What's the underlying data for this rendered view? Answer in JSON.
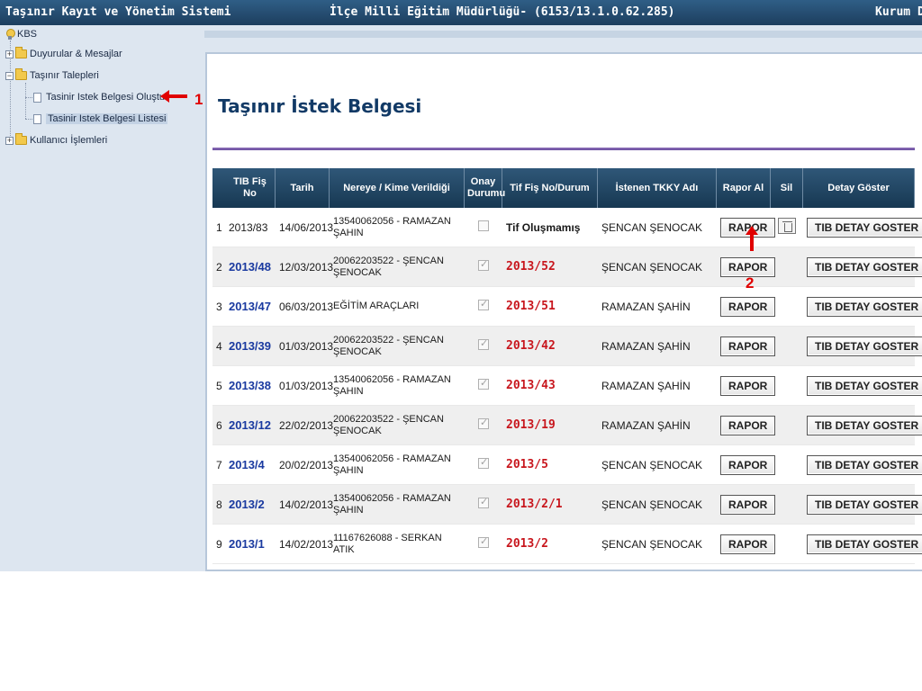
{
  "header": {
    "left_title": "Taşınır Kayıt ve Yönetim Sistemi",
    "center_title": "İlçe Milli Eğitim Müdürlüğü- (6153/13.1.0.62.285)",
    "right_title": "Kurum De"
  },
  "sidebar": {
    "root_label": "KBS",
    "items": [
      {
        "label": "Duyurular & Mesajlar"
      },
      {
        "label": "Taşınır Talepleri"
      },
      {
        "label": "Tasinir Istek Belgesi Oluştur"
      },
      {
        "label": "Tasinir Istek Belgesi Listesi"
      },
      {
        "label": "Kullanıcı İşlemleri"
      }
    ]
  },
  "annotations": {
    "first": "1",
    "second": "2"
  },
  "main": {
    "title": "Taşınır İstek Belgesi",
    "columns": [
      "TIB Fiş No",
      "Tarih",
      "Nereye / Kime Verildiği",
      "Onay Durumu",
      "Tif Fiş No/Durum",
      "İstenen TKKY Adı",
      "Rapor Al",
      "Sil",
      "Detay Göster"
    ],
    "rows": [
      {
        "no": "1",
        "fis": "2013/83",
        "tarih": "14/06/2013",
        "nereye": "13540062056 - RAMAZAN ŞAHIN",
        "onay": false,
        "tif": "Tif Oluşmamış",
        "tkky": "ŞENCAN ŞENOCAK",
        "rapor": "RAPOR",
        "detay": "TIB DETAY GOSTER"
      },
      {
        "no": "2",
        "fis": "2013/48",
        "tarih": "12/03/2013",
        "nereye": "20062203522 - ŞENCAN ŞENOCAK",
        "onay": true,
        "tif": "2013/52",
        "tkky": "ŞENCAN ŞENOCAK",
        "rapor": "RAPOR",
        "detay": "TIB DETAY GOSTER"
      },
      {
        "no": "3",
        "fis": "2013/47",
        "tarih": "06/03/2013",
        "nereye": "EĞİTİM ARAÇLARI",
        "onay": true,
        "tif": "2013/51",
        "tkky": "RAMAZAN ŞAHİN",
        "rapor": "RAPOR",
        "detay": "TIB DETAY GOSTER"
      },
      {
        "no": "4",
        "fis": "2013/39",
        "tarih": "01/03/2013",
        "nereye": "20062203522 - ŞENCAN ŞENOCAK",
        "onay": true,
        "tif": "2013/42",
        "tkky": "RAMAZAN ŞAHİN",
        "rapor": "RAPOR",
        "detay": "TIB DETAY GOSTER"
      },
      {
        "no": "5",
        "fis": "2013/38",
        "tarih": "01/03/2013",
        "nereye": "13540062056 - RAMAZAN ŞAHIN",
        "onay": true,
        "tif": "2013/43",
        "tkky": "RAMAZAN ŞAHİN",
        "rapor": "RAPOR",
        "detay": "TIB DETAY GOSTER"
      },
      {
        "no": "6",
        "fis": "2013/12",
        "tarih": "22/02/2013",
        "nereye": "20062203522 - ŞENCAN ŞENOCAK",
        "onay": true,
        "tif": "2013/19",
        "tkky": "RAMAZAN ŞAHİN",
        "rapor": "RAPOR",
        "detay": "TIB DETAY GOSTER"
      },
      {
        "no": "7",
        "fis": "2013/4",
        "tarih": "20/02/2013",
        "nereye": "13540062056 - RAMAZAN ŞAHIN",
        "onay": true,
        "tif": "2013/5",
        "tkky": "ŞENCAN ŞENOCAK",
        "rapor": "RAPOR",
        "detay": "TIB DETAY GOSTER"
      },
      {
        "no": "8",
        "fis": "2013/2",
        "tarih": "14/02/2013",
        "nereye": "13540062056 - RAMAZAN ŞAHIN",
        "onay": true,
        "tif": "2013/2/1",
        "tkky": "ŞENCAN ŞENOCAK",
        "rapor": "RAPOR",
        "detay": "TIB DETAY GOSTER"
      },
      {
        "no": "9",
        "fis": "2013/1",
        "tarih": "14/02/2013",
        "nereye": "11167626088 - SERKAN ATIK",
        "onay": true,
        "tif": "2013/2",
        "tkky": "ŞENCAN ŞENOCAK",
        "rapor": "RAPOR",
        "detay": "TIB DETAY GOSTER"
      }
    ]
  },
  "colors": {
    "header_bg": "#1d3e5e",
    "link_blue": "#1a3aa0",
    "tif_red": "#c8161d",
    "annotation_red": "#e00000",
    "title_rule_purple": "#6a4fa0"
  },
  "icons": [
    "kbs-icon",
    "folder-icon",
    "document-icon",
    "trash-icon",
    "arrow-left-icon",
    "arrow-up-icon"
  ]
}
